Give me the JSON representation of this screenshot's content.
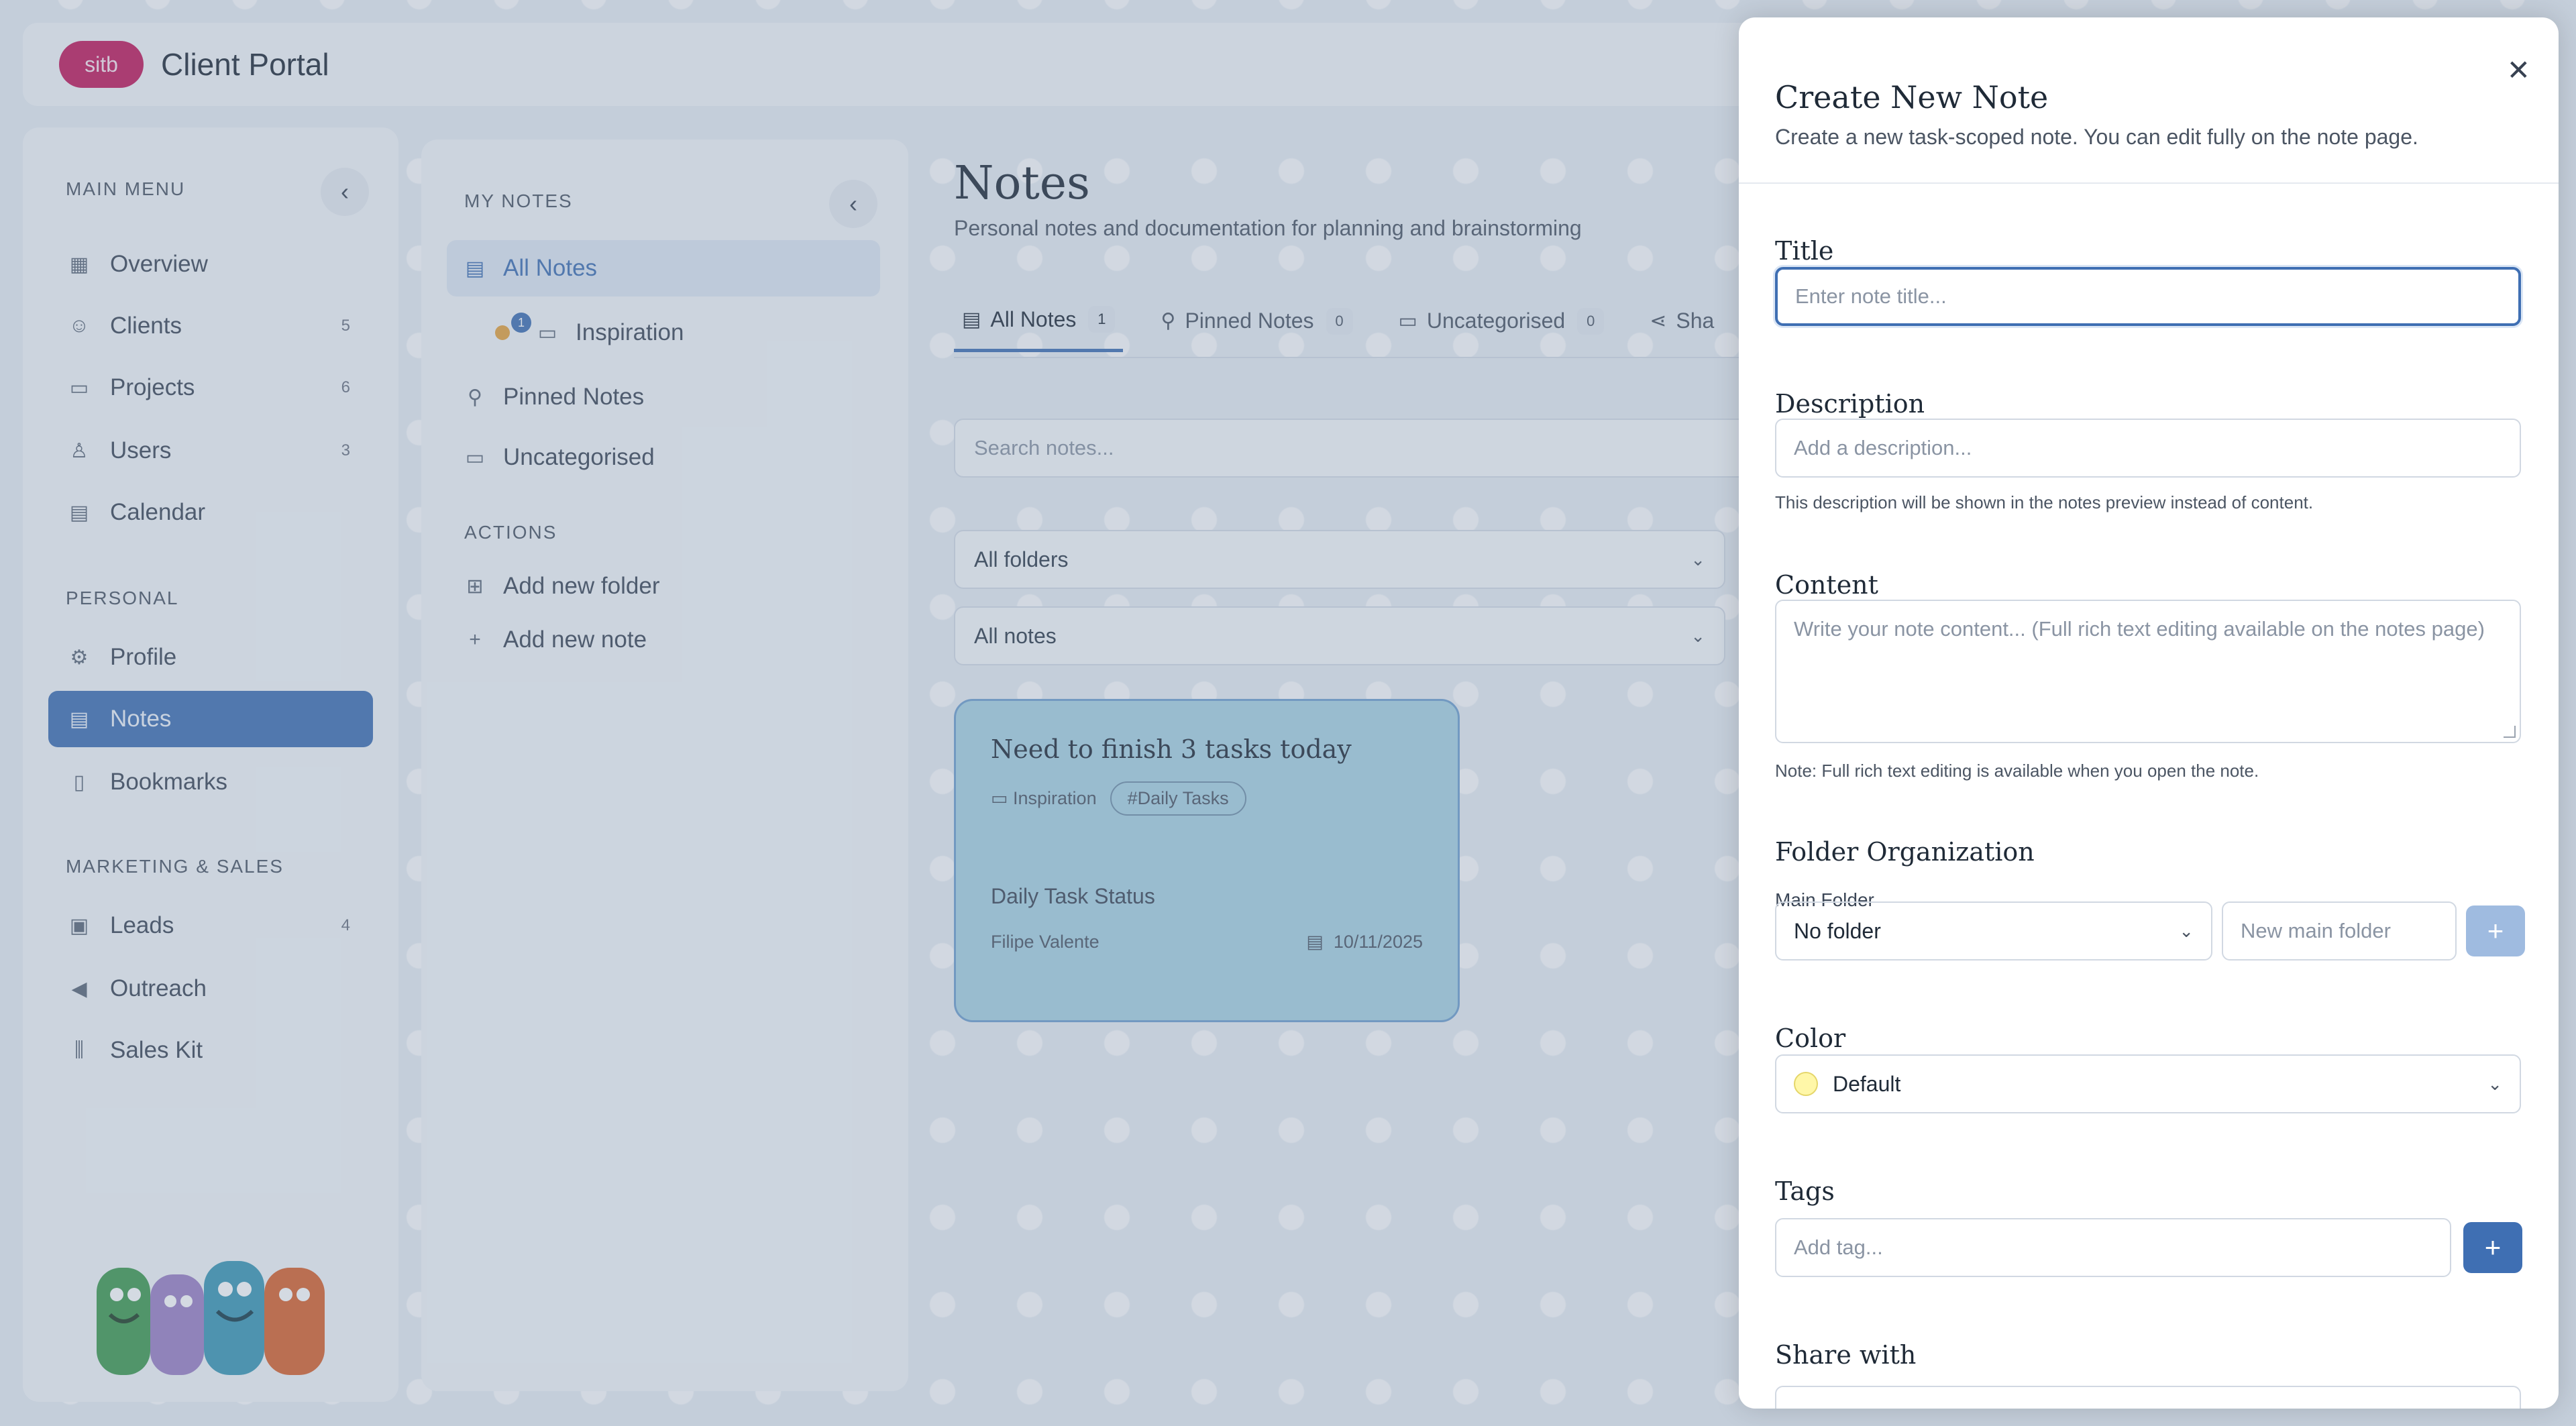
{
  "app": {
    "logo_text": "sitb",
    "title": "Client Portal"
  },
  "sidebar": {
    "main_menu_label": "MAIN MENU",
    "personal_label": "PERSONAL",
    "marketing_label": "MARKETING & SALES",
    "items": [
      {
        "label": "Overview",
        "icon": "grid-icon",
        "badge": ""
      },
      {
        "label": "Clients",
        "icon": "users-icon",
        "badge": "5"
      },
      {
        "label": "Projects",
        "icon": "folder-icon",
        "badge": "6"
      },
      {
        "label": "Users",
        "icon": "user-icon",
        "badge": "3"
      },
      {
        "label": "Calendar",
        "icon": "calendar-icon",
        "badge": ""
      },
      {
        "label": "Profile",
        "icon": "gear-icon",
        "badge": ""
      },
      {
        "label": "Notes",
        "icon": "document-icon",
        "badge": ""
      },
      {
        "label": "Bookmarks",
        "icon": "bookmark-icon",
        "badge": ""
      },
      {
        "label": "Leads",
        "icon": "contact-icon",
        "badge": "4"
      },
      {
        "label": "Outreach",
        "icon": "megaphone-icon",
        "badge": ""
      },
      {
        "label": "Sales Kit",
        "icon": "library-icon",
        "badge": ""
      }
    ]
  },
  "notes_panel": {
    "my_notes_label": "MY NOTES",
    "actions_label": "ACTIONS",
    "items": [
      {
        "label": "All Notes"
      },
      {
        "label": "Inspiration",
        "badge": "1"
      },
      {
        "label": "Pinned Notes"
      },
      {
        "label": "Uncategorised"
      }
    ],
    "actions": [
      {
        "label": "Add new folder"
      },
      {
        "label": "Add new note"
      }
    ]
  },
  "main": {
    "title": "Notes",
    "subtitle": "Personal notes and documentation for planning and brainstorming",
    "tabs": [
      {
        "label": "All Notes",
        "count": "1"
      },
      {
        "label": "Pinned Notes",
        "count": "0"
      },
      {
        "label": "Uncategorised",
        "count": "0"
      },
      {
        "label": "Sha"
      }
    ],
    "search_placeholder": "Search notes...",
    "folder_filter": "All folders",
    "notes_filter": "All notes",
    "card": {
      "title": "Need to finish 3 tasks today",
      "folder": "Inspiration",
      "tag": "#Daily Tasks",
      "status": "Daily Task Status",
      "author": "Filipe Valente",
      "date": "10/11/2025"
    }
  },
  "modal": {
    "title": "Create New Note",
    "subtitle": "Create a new task-scoped note. You can edit fully on the note page.",
    "title_label": "Title",
    "title_placeholder": "Enter note title...",
    "description_label": "Description",
    "description_placeholder": "Add a description...",
    "description_help": "This description will be shown in the notes preview instead of content.",
    "content_label": "Content",
    "content_placeholder": "Write your note content... (Full rich text editing available on the notes page)",
    "content_help": "Note: Full rich text editing is available when you open the note.",
    "folder_org_label": "Folder Organization",
    "main_folder_label": "Main Folder",
    "main_folder_value": "No folder",
    "new_main_folder_placeholder": "New main folder",
    "color_label": "Color",
    "color_value": "Default",
    "tags_label": "Tags",
    "tag_placeholder": "Add tag...",
    "share_label": "Share with"
  },
  "colors": {
    "accent": "#3f6fb3",
    "logo": "#c2185b",
    "card": "#a9d3e3"
  }
}
